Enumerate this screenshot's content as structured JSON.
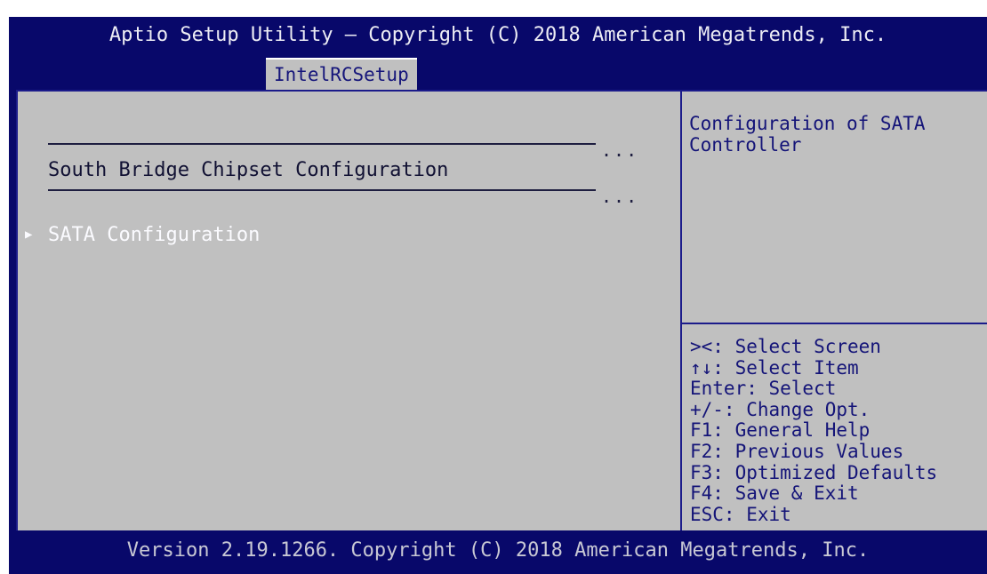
{
  "header": {
    "title": "Aptio Setup Utility – Copyright (C) 2018 American Megatrends, Inc.",
    "active_tab": "IntelRCSetup"
  },
  "main": {
    "section_title": "South Bridge Chipset Configuration",
    "separator_dots": "...",
    "items": [
      {
        "label": "SATA Configuration",
        "submenu_icon": "right-triangle-icon",
        "selected": true
      }
    ]
  },
  "help": {
    "description": "Configuration of SATA Controller",
    "keys": [
      "><: Select Screen",
      "↑↓: Select Item",
      "Enter: Select",
      "+/-: Change Opt.",
      "F1: General Help",
      "F2: Previous Values",
      "F3: Optimized Defaults",
      "F4: Save & Exit",
      "ESC: Exit"
    ]
  },
  "footer": {
    "version": "Version 2.19.1266. Copyright (C) 2018 American Megatrends, Inc."
  },
  "colors": {
    "frame": "#08086a",
    "panel": "#c0c0c0",
    "highlight_text": "#fbfbff",
    "help_text": "#141478"
  }
}
